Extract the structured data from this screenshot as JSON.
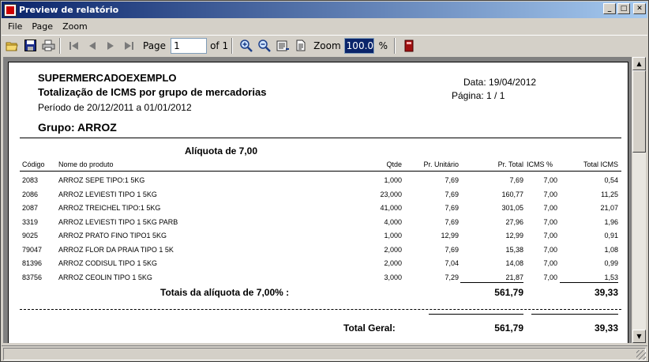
{
  "window": {
    "title": "Preview de relatório",
    "controls": {
      "minimize": "_",
      "maximize": "□",
      "close": "✕"
    }
  },
  "menu": {
    "items": [
      "File",
      "Page",
      "Zoom"
    ]
  },
  "toolbar": {
    "page_label": "Page",
    "page_value": "1",
    "of_label": "of 1",
    "zoom_label": "Zoom",
    "zoom_value": "100.0",
    "pct_label": "%",
    "icons": [
      "open-icon",
      "save-icon",
      "print-icon",
      "first-page-icon",
      "prev-page-icon",
      "next-page-icon",
      "last-page-icon",
      "zoom-in-icon",
      "zoom-out-icon",
      "page-width-icon",
      "whole-page-icon",
      "exit-icon"
    ]
  },
  "report": {
    "company": "SUPERMERCADOEXEMPLO",
    "title": "Totalização de ICMS por grupo de mercadorias",
    "period": "Período de 20/12/2011  a  01/01/2012",
    "date": "Data: 19/04/2012",
    "page": "Página: 1 / 1",
    "group": "Grupo: ARROZ",
    "aliquota_title": "Alíquota de 7,00",
    "columns": [
      "Código",
      "Nome do produto",
      "Qtde",
      "Pr. Unitário",
      "Pr. Total",
      "ICMS  %",
      "Total  ICMS"
    ],
    "rows": [
      [
        "2083",
        "ARROZ  SEPE  TIPO:1  5KG",
        "1,000",
        "7,69",
        "7,69",
        "7,00",
        "0,54"
      ],
      [
        "2086",
        "ARROZ  LEVIESTI  TIPO 1  5KG",
        "23,000",
        "7,69",
        "160,77",
        "7,00",
        "11,25"
      ],
      [
        "2087",
        "ARROZ  TREICHEL  TIPO:1  5KG",
        "41,000",
        "7,69",
        "301,05",
        "7,00",
        "21,07"
      ],
      [
        "3319",
        "ARROZ  LEVIESTI  TIPO 1  5KG  PARB",
        "4,000",
        "7,69",
        "27,96",
        "7,00",
        "1,96"
      ],
      [
        "9025",
        "ARROZ  PRATO  FINO  TIPO1  5KG",
        "1,000",
        "12,99",
        "12,99",
        "7,00",
        "0,91"
      ],
      [
        "79047",
        "ARROZ  FLOR  DA  PRAIA  TIPO  1  5K",
        "2,000",
        "7,69",
        "15,38",
        "7,00",
        "1,08"
      ],
      [
        "81396",
        "ARROZ  CODISUL  TIPO  1  5KG",
        "2,000",
        "7,04",
        "14,08",
        "7,00",
        "0,99"
      ],
      [
        "83756",
        "ARROZ  CEOLIN  TIPO  1  5KG",
        "3,000",
        "7,29",
        "21,87",
        "7,00",
        "1,53"
      ]
    ],
    "subtotal_label": "Totais da alíquota de 7,00% :",
    "subtotal_total": "561,79",
    "subtotal_icms": "39,33",
    "grand_label": "Total Geral:",
    "grand_total": "561,79",
    "grand_icms": "39,33"
  }
}
